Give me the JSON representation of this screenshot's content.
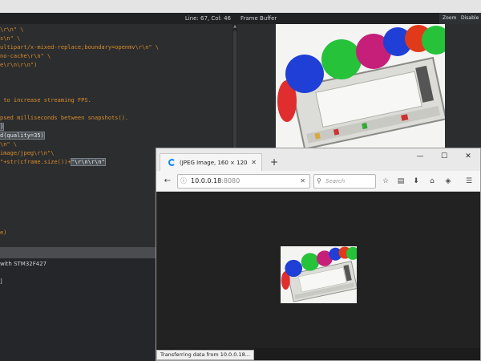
{
  "ide": {
    "editor": {
      "cursor_position": "Line: 67, Col: 46",
      "code_lines": [
        {
          "text": "",
          "tail": "\\r\\n\" \\",
          "hl": ""
        },
        {
          "text": "s\\n\" \\",
          "tail": "",
          "hl": ""
        },
        {
          "text": "ultipart/x-mixed-replace;boundary=openmv\\r\\n\" \\",
          "tail": "",
          "hl": ""
        },
        {
          "text": "no-cache\\r\\n\" \\",
          "tail": "",
          "hl": ""
        },
        {
          "text": "e\\r\\n\\r\\n\")",
          "tail": "",
          "hl": ""
        },
        {
          "text": "",
          "tail": "",
          "hl": ""
        },
        {
          "text": "",
          "tail": "",
          "hl": ""
        },
        {
          "text": "",
          "tail": "",
          "hl": ""
        },
        {
          "text": " to increase streaming FPS.",
          "tail": "",
          "hl": ""
        },
        {
          "text": "",
          "tail": "",
          "hl": ""
        },
        {
          "text": "psed milliseconds between snapshots().",
          "tail": "",
          "hl": ""
        },
        {
          "text": "",
          "tail": "",
          "hl": ")"
        },
        {
          "text": "",
          "tail": "",
          "hl": "d(quality=35)"
        },
        {
          "text": "\\n\" \\",
          "tail": "",
          "hl": ""
        },
        {
          "text": "image/jpeg\\r\\n\"\\",
          "tail": "",
          "hl": ""
        },
        {
          "text": "\"+str(cframe.size())+",
          "tail": "",
          "hl": "\"\\r\\n\\r\\n\""
        },
        {
          "text": "",
          "tail": "",
          "hl": ""
        },
        {
          "text": "",
          "tail": "",
          "hl": ""
        },
        {
          "text": "",
          "tail": "",
          "hl": ""
        },
        {
          "text": "",
          "tail": "",
          "hl": ""
        },
        {
          "text": "",
          "tail": "",
          "hl": ""
        },
        {
          "text": "",
          "tail": "",
          "hl": ""
        },
        {
          "text": "",
          "tail": "",
          "hl": ""
        },
        {
          "text": "e)",
          "tail": "",
          "hl": ""
        }
      ]
    },
    "console": {
      "lines": [
        "with STM32F427",
        "",
        "]"
      ]
    },
    "frame_buffer": {
      "title": "Frame Buffer",
      "zoom_label": "Zoom",
      "disable_label": "Disable"
    }
  },
  "browser": {
    "tab_title": "(JPEG Image, 160 × 120 pix...",
    "new_tab_label": "+",
    "url_host": "10.0.0.18",
    "url_port": ":8080",
    "search_placeholder": "Search",
    "status_text": "Transferring data from 10.0.0.18...",
    "accent_color": "#0a84ff"
  },
  "icons": [
    "back-arrow-icon",
    "info-icon",
    "clear-icon",
    "search-icon",
    "star-icon",
    "clipboard-icon",
    "download-icon",
    "home-icon",
    "pocket-icon",
    "menu-icon",
    "spinner-icon",
    "minimize-icon",
    "maximize-icon",
    "close-icon"
  ]
}
